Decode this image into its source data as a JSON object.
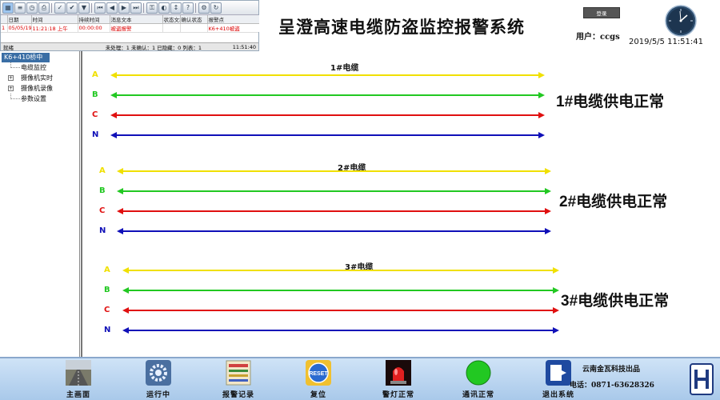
{
  "header": {
    "title": "呈澄高速电缆防盗监控报警系统",
    "logout_label": "登录",
    "user_label": "用户：ccgs",
    "datetime": "2019/5/5 11:51:41"
  },
  "alarm_panel": {
    "columns": [
      "日期",
      "时间",
      "持续时间",
      "消息文本",
      "状态文本",
      "确认状态",
      "报警点"
    ],
    "rows": [
      {
        "index": "1",
        "date": "05/05/19",
        "time": "11:21:18 上午",
        "duration": "00:00:00",
        "message": "被盗报警",
        "state": "",
        "ack": "",
        "point": "K6+410被盗"
      }
    ],
    "status_ready": "就绪",
    "status_counts": "未处理：1  未确认：1  已隐藏：0  列表：1",
    "status_clock": "11:51:40"
  },
  "sidebar": {
    "root": "K6+410桥中",
    "items": [
      {
        "label": "电缆监控",
        "expandable": false
      },
      {
        "label": "摄像机实时",
        "expandable": true
      },
      {
        "label": "摄像机录像",
        "expandable": true
      },
      {
        "label": "参数设置",
        "expandable": false
      }
    ]
  },
  "cables": [
    {
      "name": "1#电缆",
      "status": "1#电缆供电正常"
    },
    {
      "name": "2#电缆",
      "status": "2#电缆供电正常"
    },
    {
      "name": "3#电缆",
      "status": "3#电缆供电正常"
    }
  ],
  "phases": [
    {
      "label": "A",
      "color": "#f0e000"
    },
    {
      "label": "B",
      "color": "#22c822"
    },
    {
      "label": "C",
      "color": "#e01010"
    },
    {
      "label": "N",
      "color": "#1010b8"
    }
  ],
  "bottom_bar": {
    "buttons": [
      {
        "label": "主画面",
        "icon": "road-photo-icon"
      },
      {
        "label": "运行中",
        "icon": "gear-running-icon"
      },
      {
        "label": "报警记录",
        "icon": "alarm-log-icon"
      },
      {
        "label": "复位",
        "icon": "reset-icon"
      },
      {
        "label": "警灯正常",
        "icon": "warning-light-icon"
      },
      {
        "label": "通讯正常",
        "icon": "green-status-icon"
      },
      {
        "label": "退出系统",
        "icon": "exit-icon"
      }
    ],
    "vendor": "云南金瓦科技出品",
    "phone": "电话：0871-63628326"
  },
  "colors": {
    "status_ok": "#22c822",
    "highlight": "#3a6ea5",
    "bottom_bg": "#b9d5f0"
  }
}
